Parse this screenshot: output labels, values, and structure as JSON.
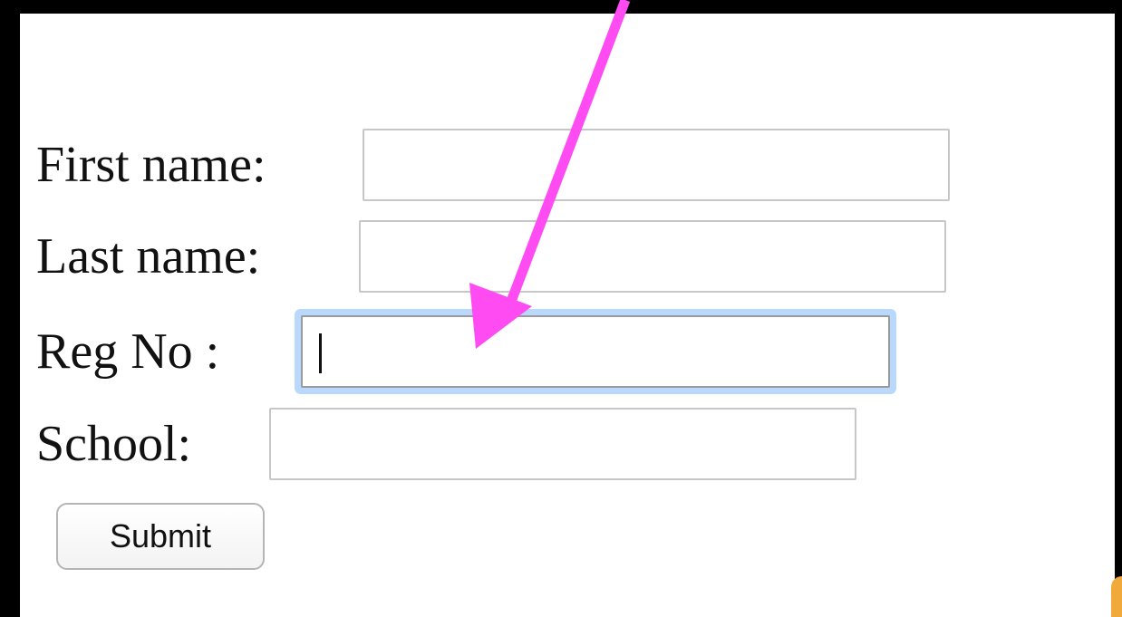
{
  "form": {
    "first_name_label": "First name:",
    "last_name_label": "Last name:",
    "reg_no_label": "Reg No :",
    "school_label": "School:",
    "first_name_value": "",
    "last_name_value": "",
    "reg_no_value": "",
    "school_value": "",
    "submit_label": "Submit"
  },
  "colors": {
    "frame": "#000000",
    "arrow": "#ff4bf2",
    "focus_ring": "#b9d8fb",
    "corner_accent": "#f2a93b"
  },
  "icons": {
    "annotation": "arrow-pointer-icon"
  }
}
